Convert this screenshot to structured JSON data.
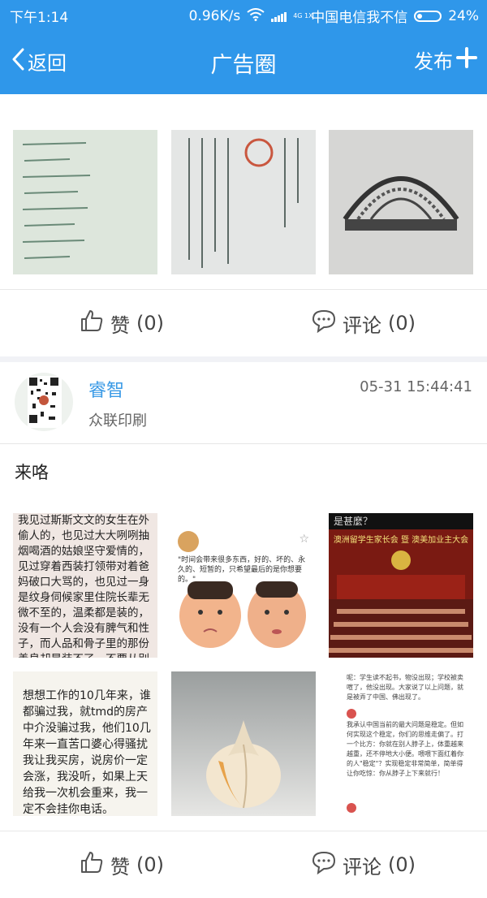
{
  "status_bar": {
    "time": "下午1:14",
    "speed": "0.96K/s",
    "network": "4G 1X",
    "carrier": "中国电信我不信",
    "battery": "24%"
  },
  "nav": {
    "back_label": "返回",
    "title": "广告圈",
    "publish_label": "发布"
  },
  "post1": {
    "like_label": "赞",
    "like_count": "(0)",
    "comment_label": "评论",
    "comment_count": "(0)"
  },
  "post2": {
    "author": "睿智",
    "company": "众联印刷",
    "time": "05-31 15:44:41",
    "text": "来咯",
    "photo1_text": "我见过斯斯文文的女生在外偷人的，也见过大大咧咧抽烟喝酒的姑娘坚守爱情的，见过穿着西装打领带对着爸妈破口大骂的，也见过一身是纹身伺候家里住院长辈无微不至的，温柔都是装的，没有一个人会没有脾气和性子，而人品和骨子里的那份善良却是装不了，不要从别人的嘴巴里去认识一个人，也不要相信眼前看到的，有些事情眼见也不一定为实，",
    "photo2_caption": "\"时间会带来很多东西，好的、坏的、永久的、短暂的，只希望最后的是你想要的。\"",
    "photo3_banner": "澳洲留学生家长会 暨 澳美加业主大会",
    "photo3_top": "是甚麼？",
    "photo4_text": "想想工作的10几年来，谁都骗过我，就tmd的房产中介没骗过我，他们10几年来一直苦口婆心得骚扰我让我买房，说房价一定会涨，我没听，如果上天给我一次机会重来，我一定不会挂你电话。",
    "photo6_text_a": "呢：学生读不起书，物没出现；学校被卖喧了，他没出现。大家说了以上问题，就是被弄了中国、佛出现了。",
    "photo6_text_b": "我承认中国当前的最大问题是稳定。但如何实现这个稳定，你们的思维走偏了。打一个比方：你就在别人脖子上，体重越来越重，还不停地大小便。喂喂下面红着你的人\"稳定\"？实现稳定非常简单，简单得让你吃惊：你从脖子上下来就行！",
    "like_label": "赞",
    "like_count": "(0)",
    "comment_label": "评论",
    "comment_count": "(0)"
  }
}
